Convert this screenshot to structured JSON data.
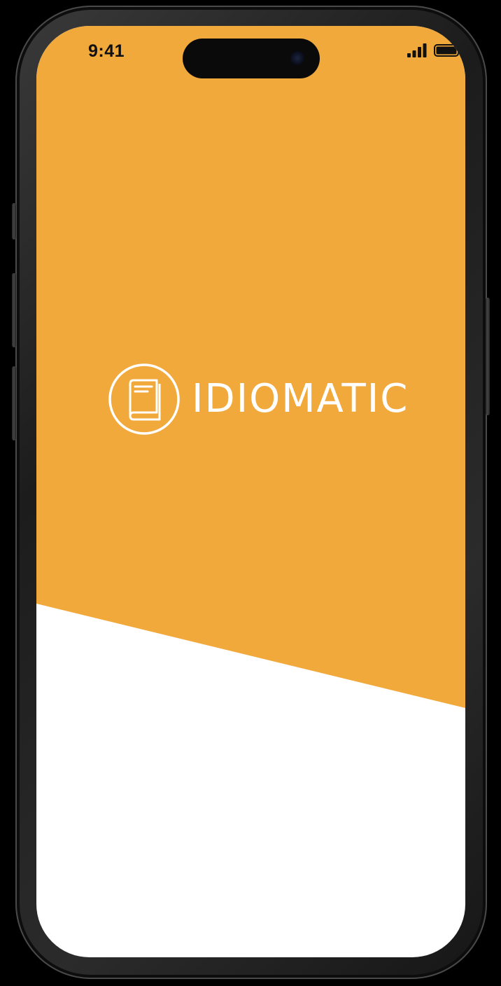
{
  "status_bar": {
    "time": "9:41",
    "signal_icon": "cellular-signal-icon",
    "battery_icon": "battery-icon"
  },
  "splash": {
    "brand_name": "IDIOMATIC",
    "logo_icon": "book-icon"
  },
  "colors": {
    "accent": "#F2A93B",
    "background": "#FFFFFF",
    "device_frame": "#1C1C1C"
  }
}
